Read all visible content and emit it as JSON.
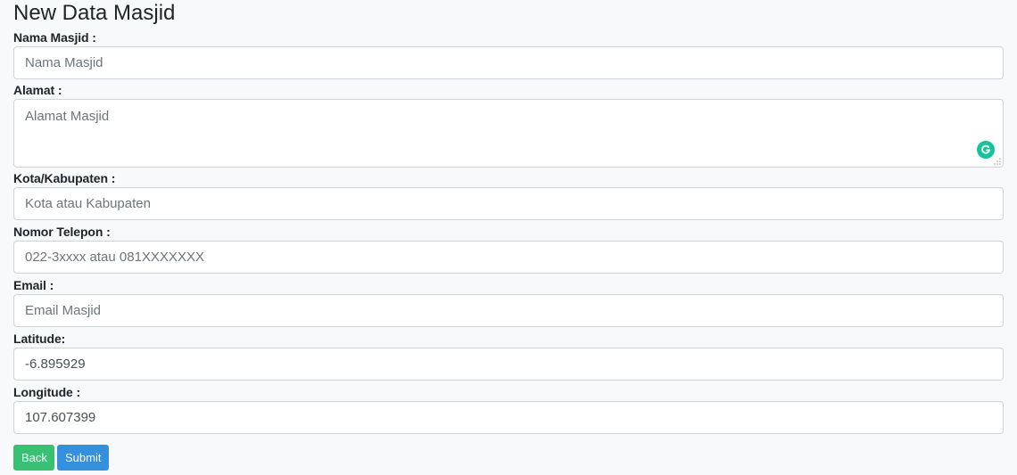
{
  "page": {
    "title": "New Data Masjid"
  },
  "form": {
    "nama": {
      "label": "Nama Masjid :",
      "placeholder": "Nama Masjid",
      "value": ""
    },
    "alamat": {
      "label": "Alamat :",
      "placeholder": "Alamat Masjid",
      "value": ""
    },
    "kota": {
      "label": "Kota/Kabupaten :",
      "placeholder": "Kota atau Kabupaten",
      "value": ""
    },
    "telepon": {
      "label": "Nomor Telepon :",
      "placeholder": "022-3xxxx atau 081XXXXXXX",
      "value": ""
    },
    "email": {
      "label": "Email :",
      "placeholder": "Email Masjid",
      "value": ""
    },
    "latitude": {
      "label": "Latitude:",
      "placeholder": "",
      "value": "-6.895929"
    },
    "longitude": {
      "label": "Longitude :",
      "placeholder": "",
      "value": "107.607399"
    }
  },
  "buttons": {
    "back": "Back",
    "submit": "Submit"
  },
  "icons": {
    "grammarly": "grammarly-icon",
    "resize": "resize-grip-icon"
  },
  "colors": {
    "back_button": "#38c172",
    "submit_button": "#3490dc",
    "grammarly": "#15c39a",
    "background": "#f8f9fb"
  }
}
